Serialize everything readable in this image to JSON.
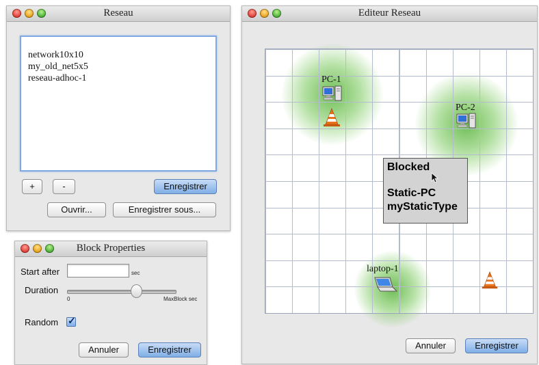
{
  "reseau_window": {
    "title": "Reseau",
    "networks": [
      "network10x10",
      "my_old_net5x5",
      "reseau-adhoc-1"
    ],
    "add_label": "+",
    "remove_label": "-",
    "save_label": "Enregistrer",
    "open_label": "Ouvrir...",
    "save_as_label": "Enregistrer sous..."
  },
  "block_window": {
    "title": "Block Properties",
    "start_after_label": "Start after",
    "start_after_value": "",
    "sec_unit": "sec",
    "duration_label": "Duration",
    "slider_min": "0",
    "slider_max": "MaxBlock sec",
    "slider_value_fraction": 0.63,
    "random_label": "Random",
    "random_checked": true,
    "cancel_label": "Annuler",
    "save_label": "Enregistrer"
  },
  "editor_window": {
    "title": "Editeur Reseau",
    "nodes": {
      "pc1": "PC-1",
      "pc2": "PC-2",
      "laptop1": "laptop-1"
    },
    "popup": {
      "status": "Blocked",
      "type": "Static-PC",
      "subtype": "myStaticType"
    },
    "cancel_label": "Annuler",
    "save_label": "Enregistrer"
  },
  "colors": {
    "accent_blue": "#7faee6",
    "glow_green": "#56b238",
    "cone_orange": "#e8731c"
  }
}
